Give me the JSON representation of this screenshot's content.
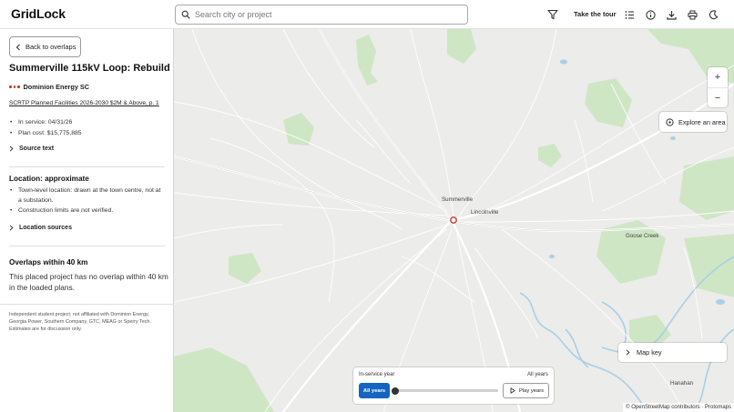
{
  "header": {
    "logo": "GridLock",
    "search_placeholder": "Search city or project",
    "tour_label": "Take the tour",
    "icons": [
      "filter-icon",
      "list-icon",
      "info-icon",
      "download-icon",
      "print-icon",
      "moon-icon"
    ]
  },
  "panel": {
    "back_label": "Back to overlaps",
    "title": "Summerville 115kV Loop: Rebuild",
    "utility": "Dominion Energy SC",
    "source_link": "SCRTP Planned Facilities 2026-2030 $2M & Above, p. 1",
    "facts": [
      "In service: 04/31/26",
      "Plan cost: $15,775,885"
    ],
    "source_text_label": "Source text",
    "location_heading": "Location: approximate",
    "location_notes": [
      "Town-level location: drawn at the town centre, not at a substation.",
      "Construction limits are not verified."
    ],
    "location_sources_label": "Location sources",
    "overlaps_heading": "Overlaps within 40 km",
    "overlaps_text": "This placed project has no overlap within 40 km in the loaded plans.",
    "disclaimer": "Independent student project; not affiliated with Dominion Energy, Georgia Power, Southern Company, GTC, MEAG or Sperry Tech. Estimates are for discussion only."
  },
  "map": {
    "zoom_in": "+",
    "zoom_out": "−",
    "explore_label": "Explore an area",
    "map_key_label": "Map key",
    "towns": [
      "Summerville",
      "Lincolnville",
      "Goose Creek",
      "Hanahan"
    ],
    "marker_color": "#c0392b",
    "timebar": {
      "label": "In-service year",
      "value": "All years",
      "all_years_button": "All years",
      "play_label": "Play years",
      "slider_position": 0
    },
    "attribution_osm": "© OpenStreetMap contributors",
    "attribution_sep": " · ",
    "attribution_protomaps": "Protomaps"
  },
  "colors": {
    "accent": "#1565c0",
    "map_land": "#ececea",
    "map_park": "#cfe6c5",
    "map_water": "#a9cfe6"
  }
}
